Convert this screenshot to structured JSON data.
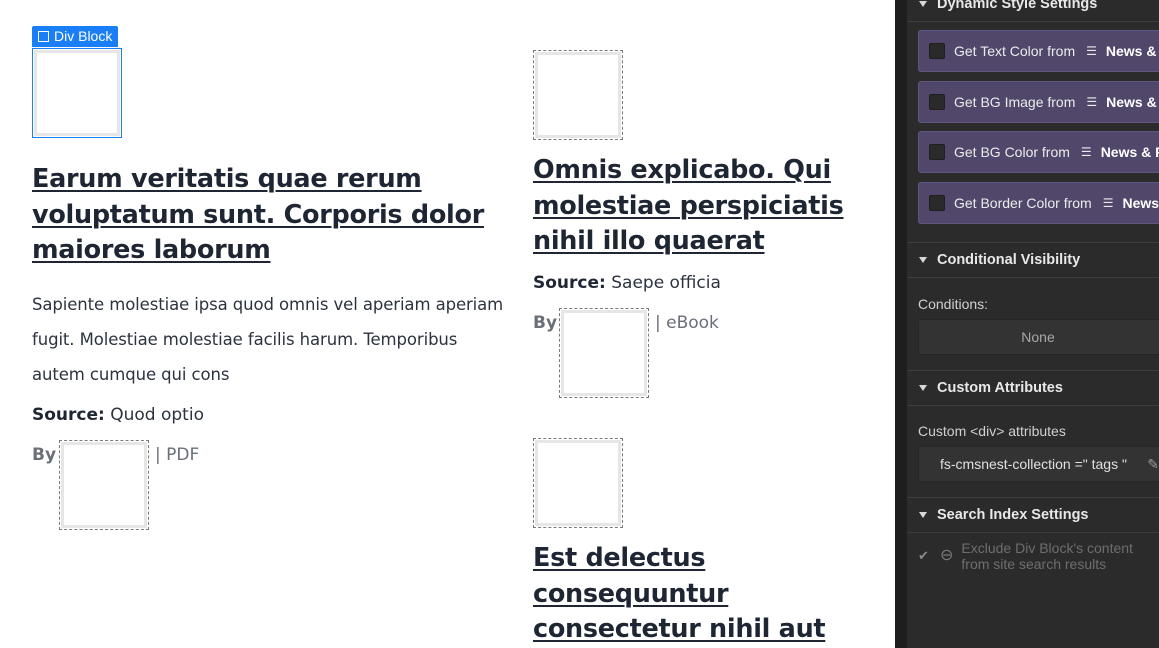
{
  "canvas": {
    "selection_label": "Div Block",
    "cards": [
      {
        "title": "Earum veritatis quae rerum voluptatum sunt. Corporis dolor maiores laborum",
        "description": "Sapiente molestiae ipsa quod omnis vel aperiam aperiam fugit. Molestiae molestiae facilis harum. Temporibus autem cumque qui cons",
        "source_label": "Source:",
        "source_value": "Quod optio",
        "by_label": "By",
        "format": "| PDF"
      },
      {
        "title": "Omnis explicabo. Qui molestiae perspiciatis nihil illo quaerat",
        "source_label": "Source:",
        "source_value": "Saepe officia",
        "by_label": "By",
        "format": "| eBook"
      },
      {
        "title": "Est delectus consequuntur consectetur nihil aut"
      }
    ]
  },
  "panel": {
    "dynamic_style_heading": "Dynamic Style Settings",
    "dynamic_rows": [
      {
        "prefix": "Get Text Color from",
        "collection": "News & P"
      },
      {
        "prefix": "Get BG Image from",
        "collection": "News & P"
      },
      {
        "prefix": "Get BG Color from",
        "collection": "News & P"
      },
      {
        "prefix": "Get Border Color from",
        "collection": "News"
      }
    ],
    "conditional_heading": "Conditional Visibility",
    "conditions_label": "Conditions:",
    "conditions_value": "None",
    "custom_attr_heading": "Custom Attributes",
    "custom_attr_label": "Custom <div> attributes",
    "custom_attr_value": "fs-cmsnest-collection =\" tags \"",
    "search_heading": "Search Index Settings",
    "search_option": "Exclude Div Block's content from site search results"
  },
  "colors": {
    "selection_blue": "#1a7ef6",
    "panel_bg": "#2b2b2b",
    "dynamic_row_bg": "#51476b"
  }
}
